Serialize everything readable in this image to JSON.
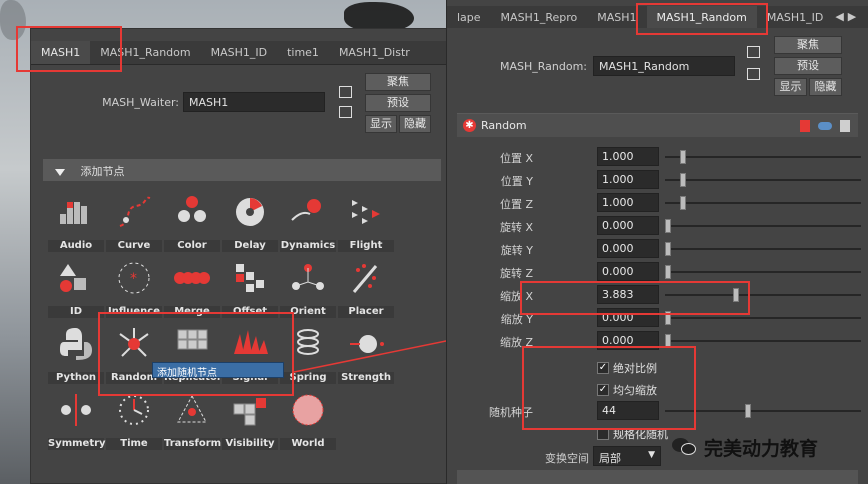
{
  "left_panel": {
    "tabs": [
      "MASH1",
      "MASH1_Random",
      "MASH1_ID",
      "time1",
      "MASH1_Distr"
    ],
    "waiter_label": "MASH_Waiter:",
    "waiter_value": "MASH1",
    "buttons": {
      "focus": "聚焦",
      "preset": "预设",
      "show": "显示",
      "hide": "隐藏"
    },
    "add_node_header": "添加节点",
    "nodes": [
      "Audio",
      "Curve",
      "Color",
      "Delay",
      "Dynamics",
      "Flight",
      "ID",
      "Influence",
      "Merge",
      "Offset",
      "Orient",
      "Placer",
      "Python",
      "Random",
      "Replicator",
      "Signal",
      "Spring",
      "Strength",
      "Symmetry",
      "Time",
      "Transform",
      "Visibility",
      "World"
    ],
    "tooltip": "添加随机节点"
  },
  "right_panel": {
    "tabs": [
      "lape",
      "MASH1_Repro",
      "MASH1",
      "MASH1_Random",
      "MASH1_ID"
    ],
    "random_label": "MASH_Random:",
    "random_value": "MASH1_Random",
    "buttons": {
      "focus": "聚焦",
      "preset": "预设",
      "show": "显示",
      "hide": "隐藏"
    },
    "section_title": "Random",
    "attributes": [
      {
        "label": "位置 X",
        "value": "1.000",
        "slider": 0.08
      },
      {
        "label": "位置 Y",
        "value": "1.000",
        "slider": 0.08
      },
      {
        "label": "位置 Z",
        "value": "1.000",
        "slider": 0.08
      },
      {
        "label": "旋转 X",
        "value": "0.000",
        "slider": 0.0
      },
      {
        "label": "旋转 Y",
        "value": "0.000",
        "slider": 0.0
      },
      {
        "label": "旋转 Z",
        "value": "0.000",
        "slider": 0.0
      },
      {
        "label": "缩放 X",
        "value": "3.883",
        "slider": 0.36
      },
      {
        "label": "缩放 Y",
        "value": "0.000",
        "slider": 0.0
      },
      {
        "label": "缩放 Z",
        "value": "0.000",
        "slider": 0.0
      }
    ],
    "absolute_scale": "绝对比例",
    "uniform_scale": "均匀缩放",
    "seed_label": "随机种子",
    "seed_value": "44",
    "seed_slider": 0.42,
    "normalize": "规格化随机",
    "space_label": "变换空间",
    "space_value": "局部"
  },
  "watermark": "完美动力教育",
  "colors": {
    "accent_red": "#e53935",
    "panel": "#444444",
    "tooltip": "#3b6ea5"
  }
}
